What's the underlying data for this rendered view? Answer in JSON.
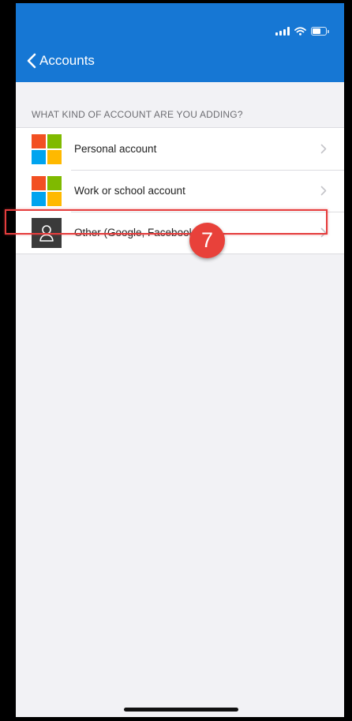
{
  "navbar": {
    "back_label": "Accounts",
    "color": "#1677d4"
  },
  "section": {
    "header": "WHAT KIND OF ACCOUNT ARE YOU ADDING?"
  },
  "accounts": [
    {
      "label": "Personal account",
      "icon": "microsoft-logo-icon"
    },
    {
      "label": "Work or school account",
      "icon": "microsoft-logo-icon"
    },
    {
      "label": "Other (Google, Facebook, etc.)",
      "icon": "person-icon"
    }
  ],
  "annotation": {
    "step_number": "7",
    "color": "#e53d3d"
  },
  "icons": {
    "status": [
      "signal-icon",
      "wifi-icon",
      "battery-icon"
    ],
    "back": "chevron-left-icon",
    "row": "chevron-right-icon"
  }
}
